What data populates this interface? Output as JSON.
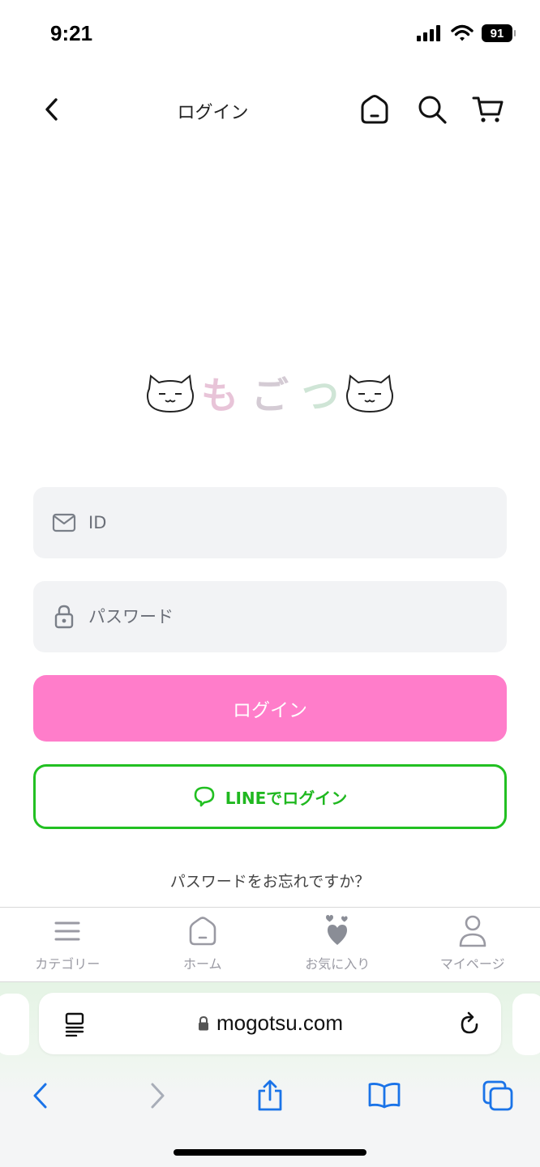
{
  "status_bar": {
    "time": "9:21",
    "battery": "91"
  },
  "header": {
    "title": "ログイン"
  },
  "icons": {
    "back": "chevron-left-icon",
    "home": "home-icon",
    "search": "search-icon",
    "cart": "cart-icon",
    "mail": "mail-icon",
    "lock": "lock-icon",
    "line": "line-chat-icon"
  },
  "logo": {
    "chars": [
      "も",
      "ご",
      "つ"
    ],
    "text": "もごつ"
  },
  "form": {
    "id_placeholder": "ID",
    "password_placeholder": "パスワード",
    "login_label": "ログイン",
    "line_login_label": "LINEでログイン",
    "forgot_label": "パスワードをお忘れですか？"
  },
  "bottom_nav": {
    "items": [
      {
        "label": "カテゴリー",
        "icon": "menu-icon"
      },
      {
        "label": "ホーム",
        "icon": "home-icon"
      },
      {
        "label": "お気に入り",
        "icon": "heart-icon"
      },
      {
        "label": "マイページ",
        "icon": "person-icon"
      }
    ]
  },
  "browser": {
    "url": "mogotsu.com"
  },
  "colors": {
    "accent_pink": "#ff7dca",
    "line_green": "#22c022",
    "field_bg": "#f2f3f5",
    "nav_gray": "#9a9aa3",
    "safari_blue": "#1a73e8"
  }
}
